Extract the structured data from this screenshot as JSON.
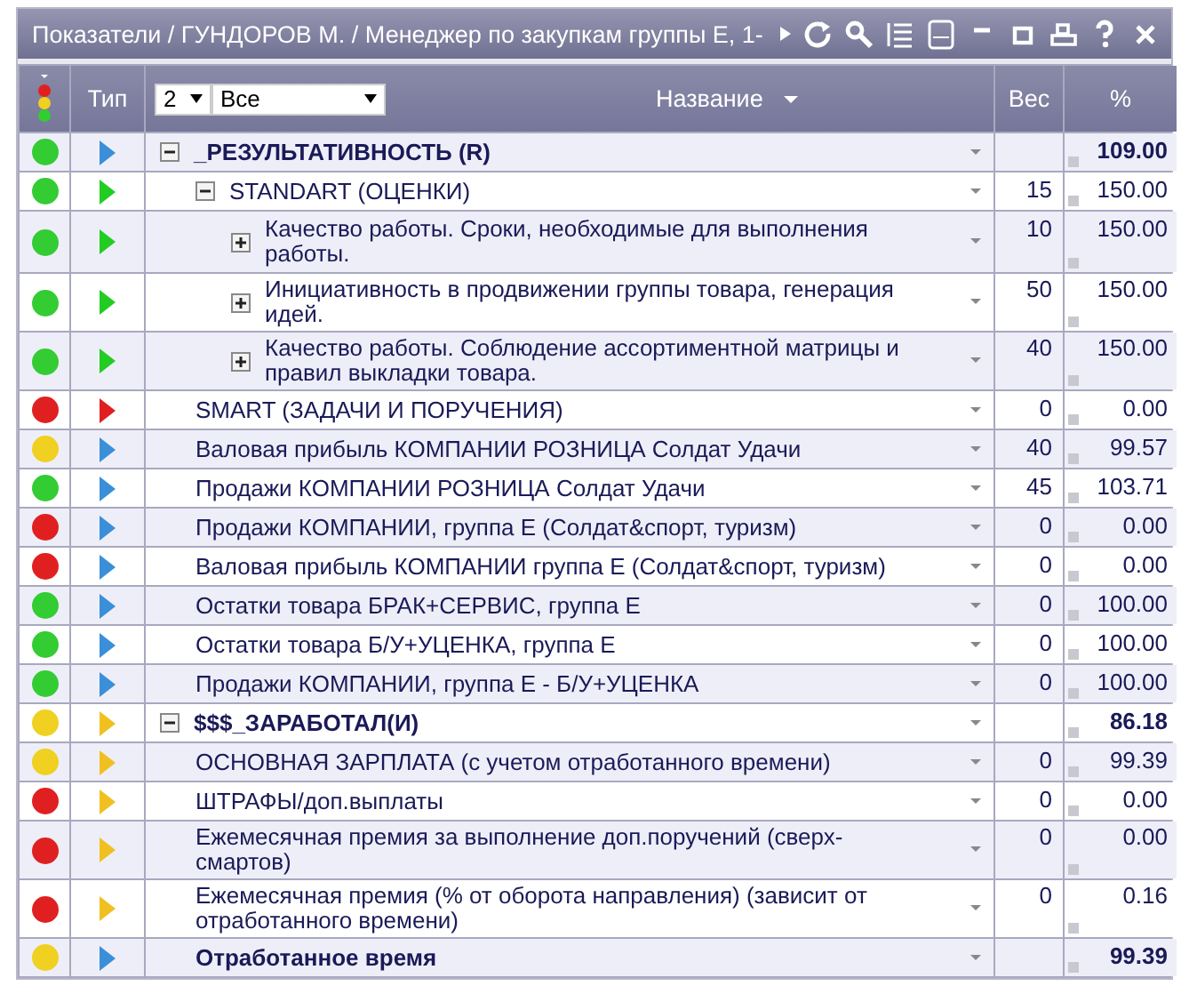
{
  "window": {
    "title": "Показатели / ГУНДОРОВ М. / Менеджер по закупкам группы Е, 1-"
  },
  "header": {
    "type_label": "Тип",
    "level_select": "2",
    "filter_select": "Все",
    "name_label": "Название",
    "weight_label": "Вес",
    "percent_label": "%"
  },
  "rows": [
    {
      "name": "_РЕЗУЛЬТАТИВНОСТЬ (R)",
      "bold": true,
      "expanded": true,
      "status_dot": {
        "color": "#33cc33"
      },
      "type_arrow": {
        "color": "#3a8fd8"
      },
      "weight": "",
      "percent": "109.00",
      "children": [
        {
          "name": "STANDART (ОЦЕНКИ)",
          "bold": false,
          "expanded": true,
          "status_dot": {
            "color": "#33cc33"
          },
          "type_arrow": {
            "color": "#22cc22"
          },
          "weight": "15",
          "percent": "150.00",
          "children": [
            {
              "name": "Качество работы. Сроки, необходимые для выполнения работы.",
              "bold": false,
              "expanded": false,
              "status_dot": {
                "color": "#33cc33"
              },
              "type_arrow": {
                "color": "#22cc22"
              },
              "weight": "10",
              "percent": "150.00"
            },
            {
              "name": "Инициативность в продвижении группы товара, генерация идей.",
              "bold": false,
              "expanded": false,
              "status_dot": {
                "color": "#33cc33"
              },
              "type_arrow": {
                "color": "#22cc22"
              },
              "weight": "50",
              "percent": "150.00"
            },
            {
              "name": "Качество работы. Соблюдение ассортиментной матрицы и правил выкладки товара.",
              "bold": false,
              "expanded": false,
              "status_dot": {
                "color": "#33cc33"
              },
              "type_arrow": {
                "color": "#22cc22"
              },
              "weight": "40",
              "percent": "150.00"
            }
          ]
        },
        {
          "name": "SMART (ЗАДАЧИ И ПОРУЧЕНИЯ)",
          "bold": false,
          "status_dot": {
            "color": "#e02020"
          },
          "type_arrow": {
            "color": "#e02020"
          },
          "weight": "0",
          "percent": "0.00"
        },
        {
          "name": "Валовая прибыль КОМПАНИИ РОЗНИЦА Солдат Удачи",
          "bold": false,
          "status_dot": {
            "color": "#f0d020"
          },
          "type_arrow": {
            "color": "#3a8fd8"
          },
          "weight": "40",
          "percent": "99.57"
        },
        {
          "name": "Продажи КОМПАНИИ РОЗНИЦА Солдат Удачи",
          "bold": false,
          "status_dot": {
            "color": "#33cc33"
          },
          "type_arrow": {
            "color": "#3a8fd8"
          },
          "weight": "45",
          "percent": "103.71"
        },
        {
          "name": "Продажи КОМПАНИИ, группа Е (Солдат&спорт, туризм)",
          "bold": false,
          "status_dot": {
            "color": "#e02020"
          },
          "type_arrow": {
            "color": "#3a8fd8"
          },
          "weight": "0",
          "percent": "0.00"
        },
        {
          "name": "Валовая прибыль КОМПАНИИ группа Е (Солдат&спорт, туризм)",
          "bold": false,
          "status_dot": {
            "color": "#e02020"
          },
          "type_arrow": {
            "color": "#3a8fd8"
          },
          "weight": "0",
          "percent": "0.00"
        },
        {
          "name": "Остатки товара БРАК+СЕРВИС, группа Е",
          "bold": false,
          "status_dot": {
            "color": "#33cc33"
          },
          "type_arrow": {
            "color": "#3a8fd8"
          },
          "weight": "0",
          "percent": "100.00"
        },
        {
          "name": "Остатки товара Б/У+УЦЕНКА, группа Е",
          "bold": false,
          "status_dot": {
            "color": "#33cc33"
          },
          "type_arrow": {
            "color": "#3a8fd8"
          },
          "weight": "0",
          "percent": "100.00"
        },
        {
          "name": "Продажи КОМПАНИИ, группа Е - Б/У+УЦЕНКА",
          "bold": false,
          "status_dot": {
            "color": "#33cc33"
          },
          "type_arrow": {
            "color": "#3a8fd8"
          },
          "weight": "0",
          "percent": "100.00"
        }
      ]
    },
    {
      "name": "$$$_ЗАРАБОТАЛ(И)",
      "bold": true,
      "expanded": true,
      "status_dot": {
        "color": "#f0d020"
      },
      "type_arrow": {
        "color": "#f0c020"
      },
      "weight": "",
      "percent": "86.18",
      "children": [
        {
          "name": "ОСНОВНАЯ ЗАРПЛАТА (с учетом отработанного времени)",
          "bold": false,
          "status_dot": {
            "color": "#f0d020"
          },
          "type_arrow": {
            "color": "#f0c020"
          },
          "weight": "0",
          "percent": "99.39"
        },
        {
          "name": "ШТРАФЫ/доп.выплаты",
          "bold": false,
          "status_dot": {
            "color": "#e02020"
          },
          "type_arrow": {
            "color": "#f0c020"
          },
          "weight": "0",
          "percent": "0.00"
        },
        {
          "name": "Ежемесячная премия за выполнение доп.поручений (сверх-смартов)",
          "bold": false,
          "status_dot": {
            "color": "#e02020"
          },
          "type_arrow": {
            "color": "#f0c020"
          },
          "weight": "0",
          "percent": "0.00"
        },
        {
          "name": "Ежемесячная премия (% от оборота направления) (зависит от отработанного времени)",
          "bold": false,
          "status_dot": {
            "color": "#e02020"
          },
          "type_arrow": {
            "color": "#f0c020"
          },
          "weight": "0",
          "percent": "0.16"
        }
      ]
    },
    {
      "name": "Отработанное время",
      "bold": true,
      "status_dot": {
        "color": "#f0d020"
      },
      "type_arrow": {
        "color": "#3a8fd8"
      },
      "weight": "",
      "percent": "99.39"
    }
  ]
}
